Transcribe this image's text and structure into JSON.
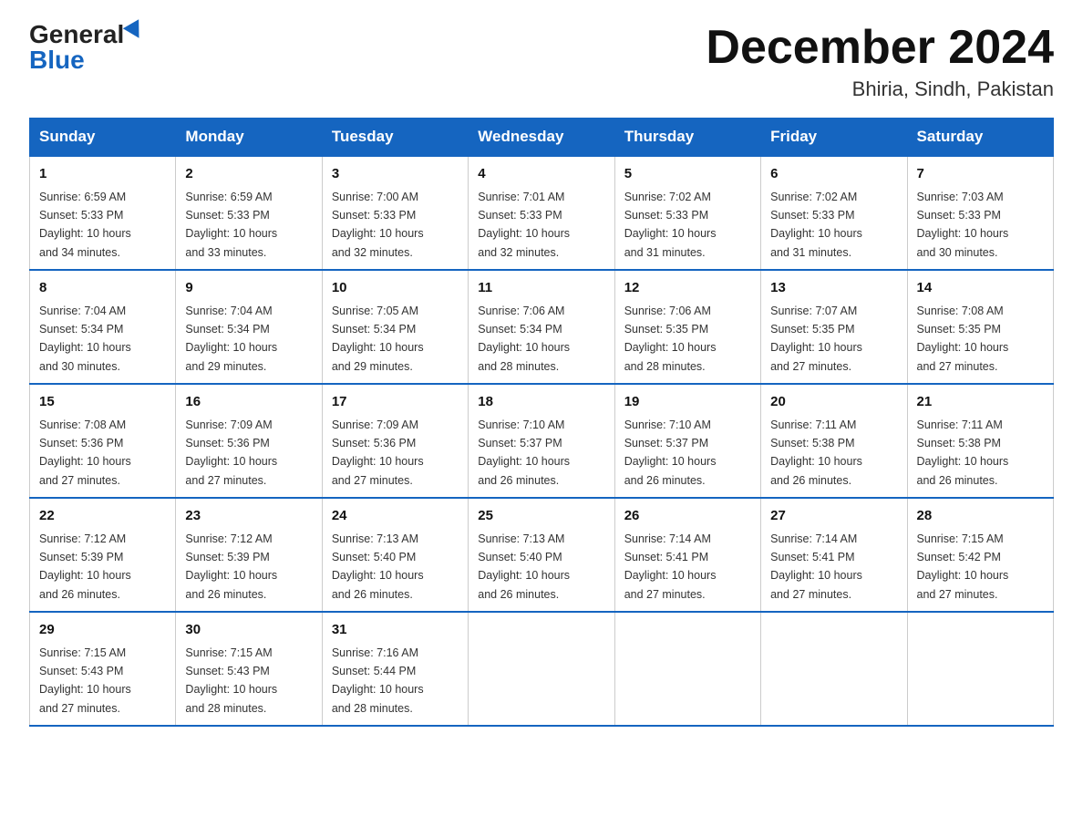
{
  "header": {
    "logo_general": "General",
    "logo_blue": "Blue",
    "month_title": "December 2024",
    "location": "Bhiria, Sindh, Pakistan"
  },
  "days_of_week": [
    "Sunday",
    "Monday",
    "Tuesday",
    "Wednesday",
    "Thursday",
    "Friday",
    "Saturday"
  ],
  "weeks": [
    [
      {
        "day": "1",
        "sunrise": "6:59 AM",
        "sunset": "5:33 PM",
        "daylight": "10 hours and 34 minutes."
      },
      {
        "day": "2",
        "sunrise": "6:59 AM",
        "sunset": "5:33 PM",
        "daylight": "10 hours and 33 minutes."
      },
      {
        "day": "3",
        "sunrise": "7:00 AM",
        "sunset": "5:33 PM",
        "daylight": "10 hours and 32 minutes."
      },
      {
        "day": "4",
        "sunrise": "7:01 AM",
        "sunset": "5:33 PM",
        "daylight": "10 hours and 32 minutes."
      },
      {
        "day": "5",
        "sunrise": "7:02 AM",
        "sunset": "5:33 PM",
        "daylight": "10 hours and 31 minutes."
      },
      {
        "day": "6",
        "sunrise": "7:02 AM",
        "sunset": "5:33 PM",
        "daylight": "10 hours and 31 minutes."
      },
      {
        "day": "7",
        "sunrise": "7:03 AM",
        "sunset": "5:33 PM",
        "daylight": "10 hours and 30 minutes."
      }
    ],
    [
      {
        "day": "8",
        "sunrise": "7:04 AM",
        "sunset": "5:34 PM",
        "daylight": "10 hours and 30 minutes."
      },
      {
        "day": "9",
        "sunrise": "7:04 AM",
        "sunset": "5:34 PM",
        "daylight": "10 hours and 29 minutes."
      },
      {
        "day": "10",
        "sunrise": "7:05 AM",
        "sunset": "5:34 PM",
        "daylight": "10 hours and 29 minutes."
      },
      {
        "day": "11",
        "sunrise": "7:06 AM",
        "sunset": "5:34 PM",
        "daylight": "10 hours and 28 minutes."
      },
      {
        "day": "12",
        "sunrise": "7:06 AM",
        "sunset": "5:35 PM",
        "daylight": "10 hours and 28 minutes."
      },
      {
        "day": "13",
        "sunrise": "7:07 AM",
        "sunset": "5:35 PM",
        "daylight": "10 hours and 27 minutes."
      },
      {
        "day": "14",
        "sunrise": "7:08 AM",
        "sunset": "5:35 PM",
        "daylight": "10 hours and 27 minutes."
      }
    ],
    [
      {
        "day": "15",
        "sunrise": "7:08 AM",
        "sunset": "5:36 PM",
        "daylight": "10 hours and 27 minutes."
      },
      {
        "day": "16",
        "sunrise": "7:09 AM",
        "sunset": "5:36 PM",
        "daylight": "10 hours and 27 minutes."
      },
      {
        "day": "17",
        "sunrise": "7:09 AM",
        "sunset": "5:36 PM",
        "daylight": "10 hours and 27 minutes."
      },
      {
        "day": "18",
        "sunrise": "7:10 AM",
        "sunset": "5:37 PM",
        "daylight": "10 hours and 26 minutes."
      },
      {
        "day": "19",
        "sunrise": "7:10 AM",
        "sunset": "5:37 PM",
        "daylight": "10 hours and 26 minutes."
      },
      {
        "day": "20",
        "sunrise": "7:11 AM",
        "sunset": "5:38 PM",
        "daylight": "10 hours and 26 minutes."
      },
      {
        "day": "21",
        "sunrise": "7:11 AM",
        "sunset": "5:38 PM",
        "daylight": "10 hours and 26 minutes."
      }
    ],
    [
      {
        "day": "22",
        "sunrise": "7:12 AM",
        "sunset": "5:39 PM",
        "daylight": "10 hours and 26 minutes."
      },
      {
        "day": "23",
        "sunrise": "7:12 AM",
        "sunset": "5:39 PM",
        "daylight": "10 hours and 26 minutes."
      },
      {
        "day": "24",
        "sunrise": "7:13 AM",
        "sunset": "5:40 PM",
        "daylight": "10 hours and 26 minutes."
      },
      {
        "day": "25",
        "sunrise": "7:13 AM",
        "sunset": "5:40 PM",
        "daylight": "10 hours and 26 minutes."
      },
      {
        "day": "26",
        "sunrise": "7:14 AM",
        "sunset": "5:41 PM",
        "daylight": "10 hours and 27 minutes."
      },
      {
        "day": "27",
        "sunrise": "7:14 AM",
        "sunset": "5:41 PM",
        "daylight": "10 hours and 27 minutes."
      },
      {
        "day": "28",
        "sunrise": "7:15 AM",
        "sunset": "5:42 PM",
        "daylight": "10 hours and 27 minutes."
      }
    ],
    [
      {
        "day": "29",
        "sunrise": "7:15 AM",
        "sunset": "5:43 PM",
        "daylight": "10 hours and 27 minutes."
      },
      {
        "day": "30",
        "sunrise": "7:15 AM",
        "sunset": "5:43 PM",
        "daylight": "10 hours and 28 minutes."
      },
      {
        "day": "31",
        "sunrise": "7:16 AM",
        "sunset": "5:44 PM",
        "daylight": "10 hours and 28 minutes."
      },
      null,
      null,
      null,
      null
    ]
  ],
  "labels": {
    "sunrise": "Sunrise:",
    "sunset": "Sunset:",
    "daylight": "Daylight:"
  }
}
